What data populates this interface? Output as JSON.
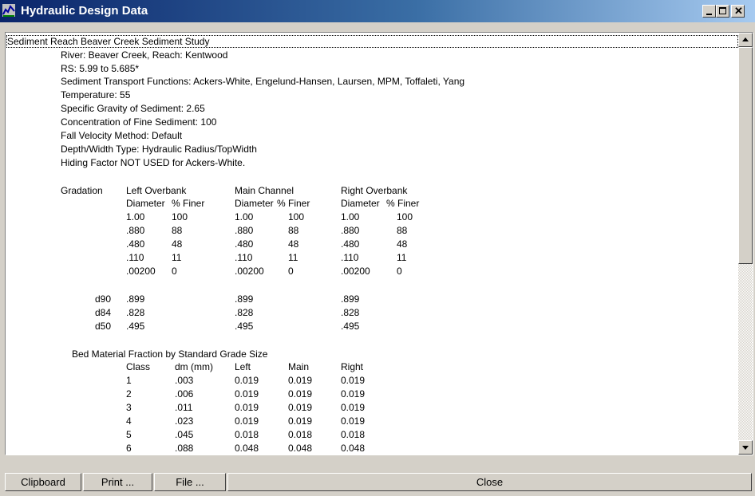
{
  "window": {
    "title": "Hydraulic Design Data"
  },
  "report": {
    "title": "Sediment Reach Beaver Creek Sediment Study",
    "header_lines": [
      "River: Beaver Creek, Reach: Kentwood",
      "RS: 5.99 to 5.685*",
      "Sediment Transport Functions: Ackers-White, Engelund-Hansen, Laursen, MPM, Toffaleti, Yang",
      "Temperature: 55",
      "Specific Gravity of Sediment: 2.65",
      "Concentration of Fine Sediment: 100",
      "Fall Velocity Method: Default",
      "Depth/Width Type: Hydraulic Radius/TopWidth",
      "Hiding Factor NOT USED for Ackers-White."
    ],
    "gradation": {
      "label": "Gradation",
      "groups": [
        "Left Overbank",
        "Main Channel",
        "Right Overbank"
      ],
      "subheaders": [
        "Diameter",
        "% Finer"
      ],
      "rows": [
        [
          "1.00",
          "100",
          "1.00",
          "100",
          "1.00",
          "100"
        ],
        [
          ".880",
          "88",
          ".880",
          "88",
          ".880",
          "88"
        ],
        [
          ".480",
          "48",
          ".480",
          "48",
          ".480",
          "48"
        ],
        [
          ".110",
          "11",
          ".110",
          "11",
          ".110",
          "11"
        ],
        [
          ".00200",
          "0",
          ".00200",
          "0",
          ".00200",
          "0"
        ]
      ]
    },
    "percentiles": [
      {
        "label": "d90",
        "values": [
          ".899",
          ".899",
          ".899"
        ]
      },
      {
        "label": "d84",
        "values": [
          ".828",
          ".828",
          ".828"
        ]
      },
      {
        "label": "d50",
        "values": [
          ".495",
          ".495",
          ".495"
        ]
      }
    ],
    "bed_material": {
      "title": "Bed Material Fraction by Standard Grade Size",
      "headers": [
        "Class",
        "dm (mm)",
        "Left",
        "Main",
        "Right"
      ],
      "rows": [
        [
          "1",
          ".003",
          "0.019",
          "0.019",
          "0.019"
        ],
        [
          "2",
          ".006",
          "0.019",
          "0.019",
          "0.019"
        ],
        [
          "3",
          ".011",
          "0.019",
          "0.019",
          "0.019"
        ],
        [
          "4",
          ".023",
          "0.019",
          "0.019",
          "0.019"
        ],
        [
          "5",
          ".045",
          "0.018",
          "0.018",
          "0.018"
        ],
        [
          "6",
          ".088",
          "0.048",
          "0.048",
          "0.048"
        ]
      ]
    }
  },
  "buttons": {
    "clipboard": "Clipboard",
    "print": "Print ...",
    "file": "File ...",
    "close": "Close"
  },
  "icons": {
    "app": "hydraulic-app-icon",
    "minimize": "minimize-icon",
    "maximize": "maximize-icon",
    "close": "close-icon",
    "scroll_up": "scroll-up-arrow-icon",
    "scroll_down": "scroll-down-arrow-icon"
  }
}
